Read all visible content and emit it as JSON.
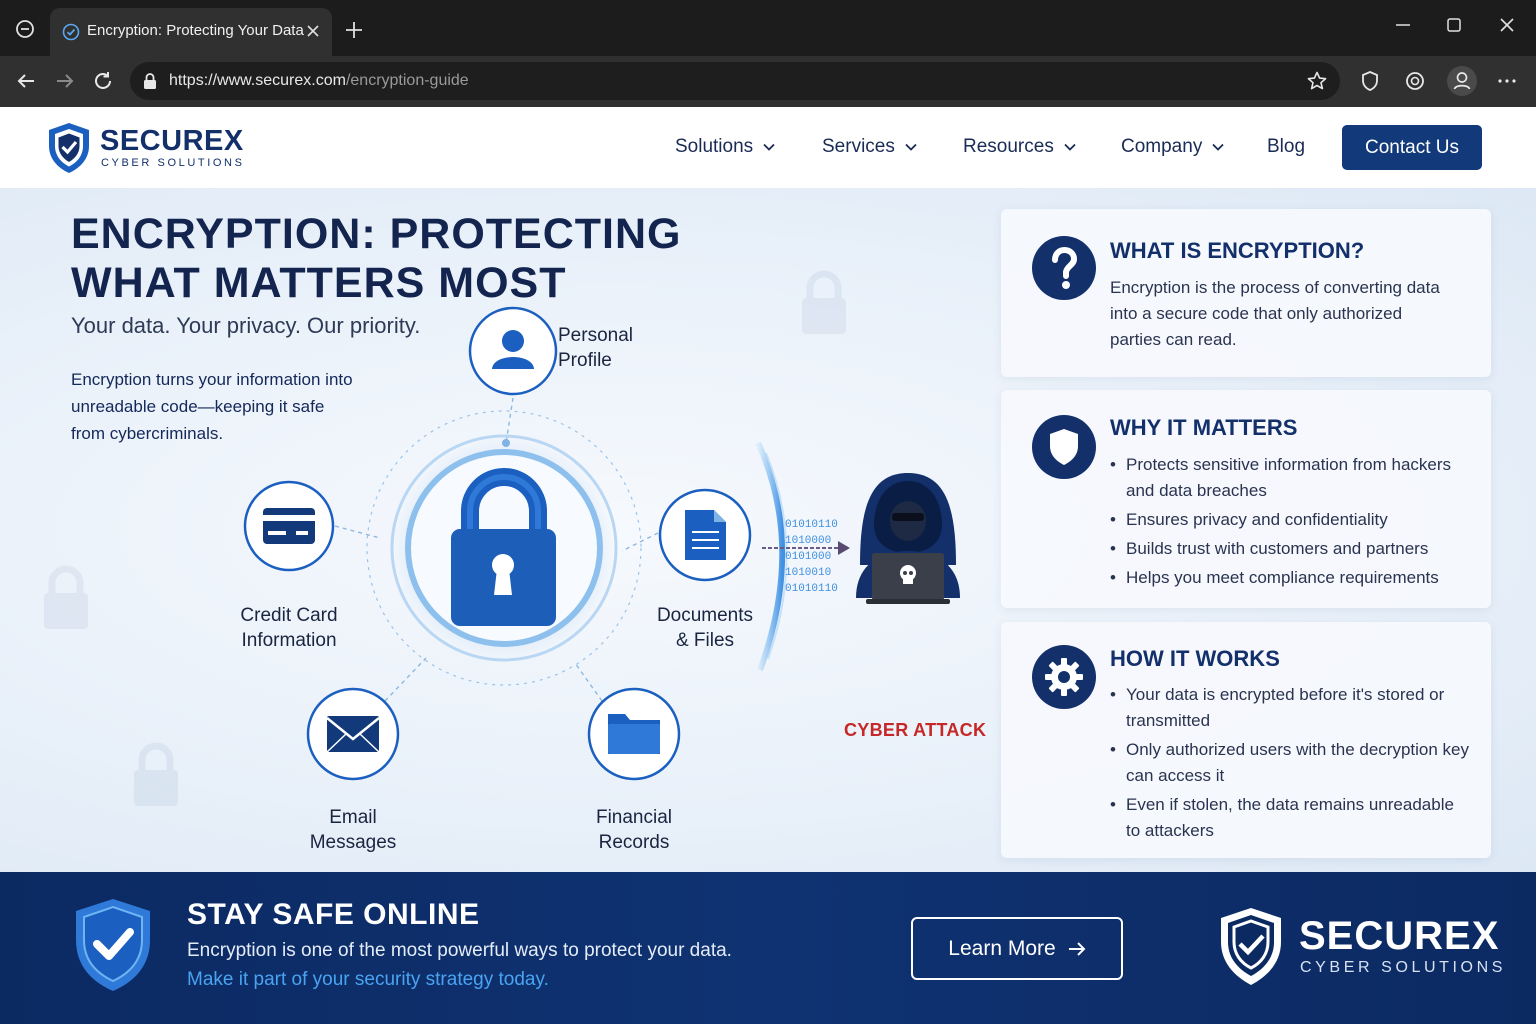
{
  "browser": {
    "tab_title": "Encryption: Protecting Your Data",
    "url_host": "https://www.securex.com",
    "url_path": "/encryption-guide"
  },
  "site": {
    "logo_name": "SECUREX",
    "logo_sub": "CYBER SOLUTIONS",
    "nav": {
      "solutions": "Solutions",
      "services": "Services",
      "resources": "Resources",
      "company": "Company",
      "blog": "Blog"
    },
    "contact_label": "Contact Us"
  },
  "hero": {
    "title": "ENCRYPTION: PROTECTING WHAT MATTERS MOST",
    "subtitle": "Your data. Your privacy. Our priority.",
    "description": "Encryption turns your information into unreadable code—keeping it safe from cybercriminals."
  },
  "diagram": {
    "personal_profile": "Personal Profile",
    "credit_card": "Credit Card Information",
    "documents": "Documents & Files",
    "email": "Email Messages",
    "financial": "Financial Records",
    "binary": [
      "01010110",
      "1010000",
      "0101000",
      "1010010",
      "01010110"
    ],
    "attack_label": "CYBER ATTACK"
  },
  "cards": {
    "what": {
      "title": "WHAT IS ENCRYPTION?",
      "text": "Encryption is the process of converting data into a secure code that only authorized parties can read."
    },
    "why": {
      "title": "WHY IT MATTERS",
      "items": [
        "Protects sensitive information from hackers and data breaches",
        "Ensures privacy and confidentiality",
        "Builds trust with customers and partners",
        "Helps you meet compliance requirements"
      ]
    },
    "how": {
      "title": "HOW IT WORKS",
      "items": [
        "Your data is encrypted before it's stored or transmitted",
        "Only authorized users with the decryption key can access it",
        "Even if stolen, the data remains unreadable to attackers"
      ]
    }
  },
  "banner": {
    "title": "STAY SAFE ONLINE",
    "line1": "Encryption is one of the most powerful ways to protect your data.",
    "line2": "Make it part of your security strategy today.",
    "button_label": "Learn More",
    "logo_name": "SECUREX",
    "logo_sub": "CYBER SOLUTIONS"
  },
  "colors": {
    "brand_navy": "#13306b",
    "accent_blue": "#1b5fc1",
    "attack_red": "#c62828",
    "banner_bg": "#0c2a62"
  }
}
